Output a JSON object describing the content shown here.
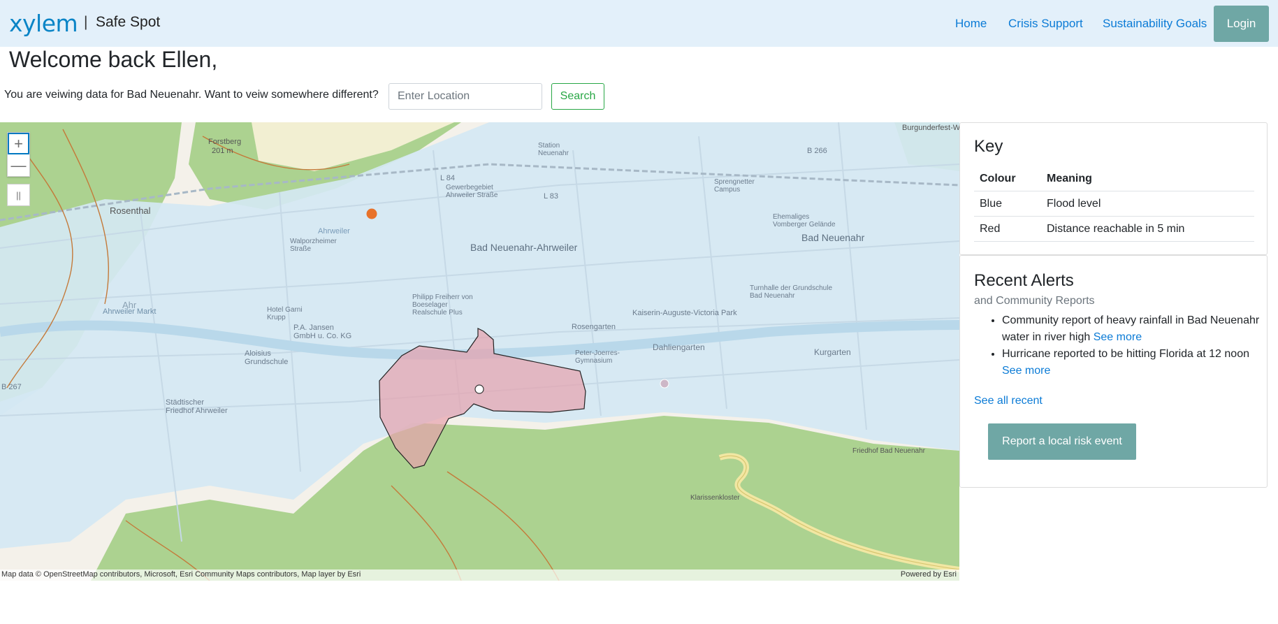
{
  "nav": {
    "logo": "xylem",
    "separator": "|",
    "app_name": "Safe Spot",
    "links": [
      "Home",
      "Crisis Support",
      "Sustainability Goals"
    ],
    "login": "Login"
  },
  "welcome": {
    "greeting": "Welcome back Ellen,",
    "location_prompt": "You are veiwing data for Bad Neuenahr. Want to veiw somewhere different?",
    "location_placeholder": "Enter Location",
    "search_label": "Search"
  },
  "map": {
    "zoom_in": "+",
    "zoom_out": "—",
    "pause": "||",
    "attribution": "Map data © OpenStreetMap contributors, Microsoft, Esri Community Maps contributors, Map layer by Esri",
    "powered_by": "Powered by Esri",
    "labels": {
      "bad_neuenahr_ahrweiler": "Bad Neuenahr-Ahrweiler",
      "bad_neuenahr": "Bad Neuenahr",
      "rosenthal": "Rosenthal",
      "forstberg": "Forstberg",
      "forstberg_elev": "201 m",
      "ahrweiler": "Ahrweiler",
      "ahr": "Ahr",
      "ahrweiler_markt": "Ahrweiler Markt",
      "l84": "L 84",
      "l83": "L 83",
      "b266": "B 266",
      "b267": "B 267",
      "kurgarten": "Kurgarten",
      "dahliengarten": "Dahliengarten",
      "klarissenkloster": "Klarissenkloster",
      "burgunderfest": "Burgunderfest-Wiese",
      "rosengarten": "Rosengarten",
      "friedhof": "Friedhof Bad Neuenahr",
      "kurpark": "Kaiserin-Auguste-Victoria Park",
      "turnhalle": "Turnhalle der Grundschule Bad Neuenahr",
      "gewerbegebiet": "Gewerbegebiet Ahrweiler Straße",
      "spring": "Sprengnetter Campus",
      "ehemaliges": "Ehemaliges Vomberger Gelände",
      "station": "Station Neuenahr",
      "pja": "P.A. Jansen GmbH u. Co. KG",
      "philipp": "Philipp Freiherr von Boeselager Realschule Plus",
      "peter": "Peter-Joerres-Gymnasium",
      "aloisius": "Aloisius Grundschule",
      "hotel": "Hotel Garni Krupp",
      "stadt": "Städtischer Friedhof Ahrweiler",
      "walporz": "Walporzheimer Straße"
    },
    "colors": {
      "flood": "#d4e8f3",
      "forest": "#a9d18e",
      "reach": "#e7a1ad",
      "road": "#c47a3a",
      "marker": "#e8722a"
    }
  },
  "key": {
    "title": "Key",
    "headers": [
      "Colour",
      "Meaning"
    ],
    "rows": [
      [
        "Blue",
        "Flood level"
      ],
      [
        "Red",
        "Distance reachable in 5 min"
      ]
    ]
  },
  "alerts": {
    "title": "Recent Alerts",
    "subtitle": "and Community Reports",
    "items": [
      {
        "text": "Community report of heavy rainfall in Bad Neuenahr water in river high",
        "link": "See more"
      },
      {
        "text": "Hurricane reported to be hitting Florida at 12 noon",
        "link": "See more"
      }
    ],
    "see_all": "See all recent",
    "report_button": "Report a local risk event"
  }
}
